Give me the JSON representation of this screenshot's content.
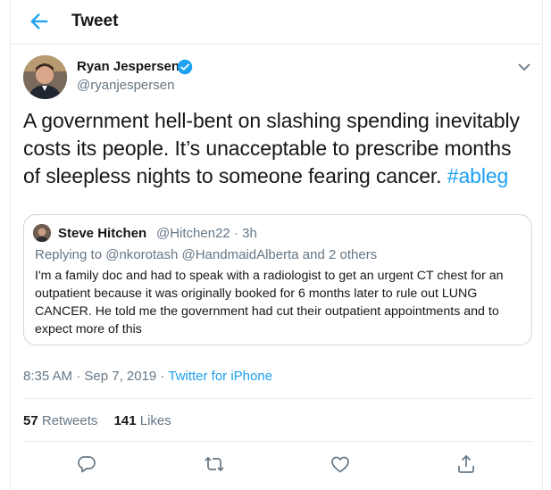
{
  "header": {
    "title": "Tweet"
  },
  "author": {
    "name": "Ryan Jespersen",
    "handle": "@ryanjespersen",
    "verified": true
  },
  "tweet": {
    "text_line1": "A government hell-bent on slashing spending inevitably",
    "text_line2": "costs its people. It’s unacceptable to prescribe months",
    "text_line3": "of sleepless nights to someone fearing cancer. ",
    "hashtag": "#ableg"
  },
  "quote": {
    "name": "Steve Hitchen",
    "meta": "@Hitchen22 · 3h",
    "replying_prefix": "Replying to ",
    "replying_mentions": "@nkorotash @HandmaidAlberta",
    "replying_suffix": " and 2 others",
    "text": "I'm a family doc and had to speak with a radiologist to get an urgent CT chest for an outpatient because it was originally booked for 6 months later to rule out LUNG CANCER. He told me the government had cut their outpatient appointments and to expect more of this"
  },
  "meta": {
    "time": "8:35 AM · Sep 7, 2019 · ",
    "source": "Twitter for iPhone"
  },
  "stats": {
    "retweets_count": "57",
    "retweets_label": " Retweets",
    "likes_count": "141",
    "likes_label": " Likes"
  },
  "icons": [
    "back-arrow-icon",
    "verified-badge-icon",
    "chevron-down-icon",
    "reply-icon",
    "retweet-icon",
    "like-icon",
    "share-icon"
  ],
  "colors": {
    "accent": "#1da1f2",
    "secondary_text": "#657786",
    "border": "#e6ecf0"
  }
}
